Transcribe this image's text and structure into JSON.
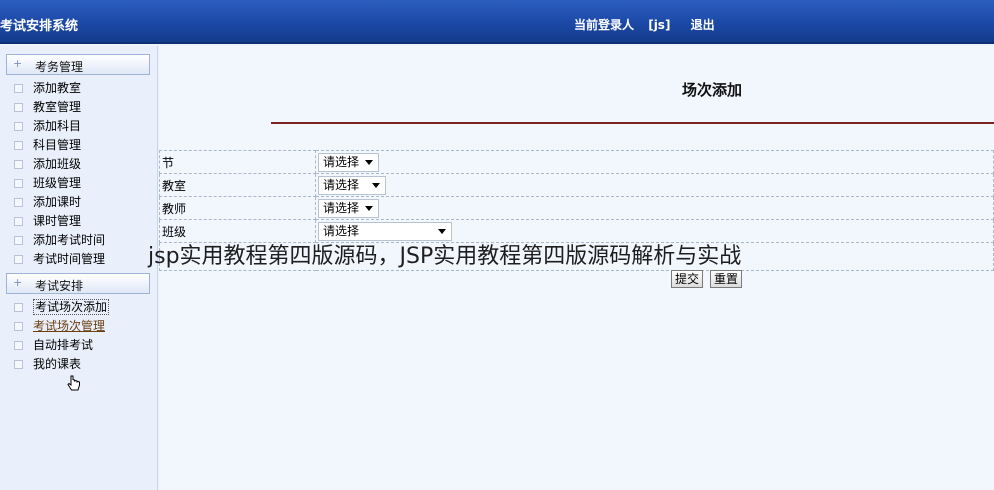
{
  "header": {
    "app_title": "考试安排系统",
    "current_user_label": "当前登录人",
    "current_user": "[js]",
    "logout_label": "退出"
  },
  "sidebar": {
    "groups": [
      {
        "label": "考务管理",
        "items": [
          "添加教室",
          "教室管理",
          "添加科目",
          "科目管理",
          "添加班级",
          "班级管理",
          "添加课时",
          "课时管理",
          "添加考试时间",
          "考试时间管理"
        ]
      },
      {
        "label": "考试安排",
        "items": [
          "考试场次添加",
          "考试场次管理",
          "自动排考试",
          "我的课表"
        ]
      }
    ]
  },
  "main": {
    "page_title": "场次添加",
    "form": {
      "fields": [
        {
          "label": "节",
          "value": "请选择"
        },
        {
          "label": "教室",
          "value": "请选择"
        },
        {
          "label": "教师",
          "value": "请选择"
        },
        {
          "label": "班级",
          "value": "请选择"
        }
      ],
      "submit_label": "提交",
      "reset_label": "重置"
    }
  },
  "overlay_caption": "jsp实用教程第四版源码，JSP实用教程第四版源码解析与实战"
}
